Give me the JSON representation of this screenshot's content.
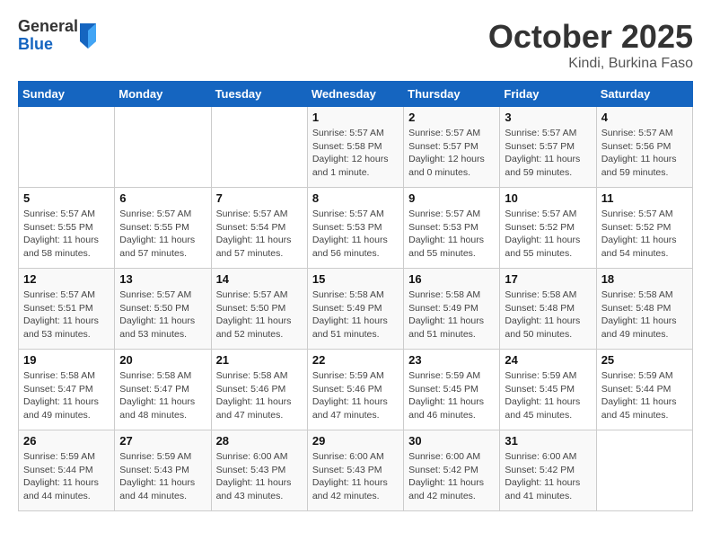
{
  "header": {
    "logo_general": "General",
    "logo_blue": "Blue",
    "month": "October 2025",
    "location": "Kindi, Burkina Faso"
  },
  "days_of_week": [
    "Sunday",
    "Monday",
    "Tuesday",
    "Wednesday",
    "Thursday",
    "Friday",
    "Saturday"
  ],
  "weeks": [
    [
      {
        "day": "",
        "info": ""
      },
      {
        "day": "",
        "info": ""
      },
      {
        "day": "",
        "info": ""
      },
      {
        "day": "1",
        "info": "Sunrise: 5:57 AM\nSunset: 5:58 PM\nDaylight: 12 hours\nand 1 minute."
      },
      {
        "day": "2",
        "info": "Sunrise: 5:57 AM\nSunset: 5:57 PM\nDaylight: 12 hours\nand 0 minutes."
      },
      {
        "day": "3",
        "info": "Sunrise: 5:57 AM\nSunset: 5:57 PM\nDaylight: 11 hours\nand 59 minutes."
      },
      {
        "day": "4",
        "info": "Sunrise: 5:57 AM\nSunset: 5:56 PM\nDaylight: 11 hours\nand 59 minutes."
      }
    ],
    [
      {
        "day": "5",
        "info": "Sunrise: 5:57 AM\nSunset: 5:55 PM\nDaylight: 11 hours\nand 58 minutes."
      },
      {
        "day": "6",
        "info": "Sunrise: 5:57 AM\nSunset: 5:55 PM\nDaylight: 11 hours\nand 57 minutes."
      },
      {
        "day": "7",
        "info": "Sunrise: 5:57 AM\nSunset: 5:54 PM\nDaylight: 11 hours\nand 57 minutes."
      },
      {
        "day": "8",
        "info": "Sunrise: 5:57 AM\nSunset: 5:53 PM\nDaylight: 11 hours\nand 56 minutes."
      },
      {
        "day": "9",
        "info": "Sunrise: 5:57 AM\nSunset: 5:53 PM\nDaylight: 11 hours\nand 55 minutes."
      },
      {
        "day": "10",
        "info": "Sunrise: 5:57 AM\nSunset: 5:52 PM\nDaylight: 11 hours\nand 55 minutes."
      },
      {
        "day": "11",
        "info": "Sunrise: 5:57 AM\nSunset: 5:52 PM\nDaylight: 11 hours\nand 54 minutes."
      }
    ],
    [
      {
        "day": "12",
        "info": "Sunrise: 5:57 AM\nSunset: 5:51 PM\nDaylight: 11 hours\nand 53 minutes."
      },
      {
        "day": "13",
        "info": "Sunrise: 5:57 AM\nSunset: 5:50 PM\nDaylight: 11 hours\nand 53 minutes."
      },
      {
        "day": "14",
        "info": "Sunrise: 5:57 AM\nSunset: 5:50 PM\nDaylight: 11 hours\nand 52 minutes."
      },
      {
        "day": "15",
        "info": "Sunrise: 5:58 AM\nSunset: 5:49 PM\nDaylight: 11 hours\nand 51 minutes."
      },
      {
        "day": "16",
        "info": "Sunrise: 5:58 AM\nSunset: 5:49 PM\nDaylight: 11 hours\nand 51 minutes."
      },
      {
        "day": "17",
        "info": "Sunrise: 5:58 AM\nSunset: 5:48 PM\nDaylight: 11 hours\nand 50 minutes."
      },
      {
        "day": "18",
        "info": "Sunrise: 5:58 AM\nSunset: 5:48 PM\nDaylight: 11 hours\nand 49 minutes."
      }
    ],
    [
      {
        "day": "19",
        "info": "Sunrise: 5:58 AM\nSunset: 5:47 PM\nDaylight: 11 hours\nand 49 minutes."
      },
      {
        "day": "20",
        "info": "Sunrise: 5:58 AM\nSunset: 5:47 PM\nDaylight: 11 hours\nand 48 minutes."
      },
      {
        "day": "21",
        "info": "Sunrise: 5:58 AM\nSunset: 5:46 PM\nDaylight: 11 hours\nand 47 minutes."
      },
      {
        "day": "22",
        "info": "Sunrise: 5:59 AM\nSunset: 5:46 PM\nDaylight: 11 hours\nand 47 minutes."
      },
      {
        "day": "23",
        "info": "Sunrise: 5:59 AM\nSunset: 5:45 PM\nDaylight: 11 hours\nand 46 minutes."
      },
      {
        "day": "24",
        "info": "Sunrise: 5:59 AM\nSunset: 5:45 PM\nDaylight: 11 hours\nand 45 minutes."
      },
      {
        "day": "25",
        "info": "Sunrise: 5:59 AM\nSunset: 5:44 PM\nDaylight: 11 hours\nand 45 minutes."
      }
    ],
    [
      {
        "day": "26",
        "info": "Sunrise: 5:59 AM\nSunset: 5:44 PM\nDaylight: 11 hours\nand 44 minutes."
      },
      {
        "day": "27",
        "info": "Sunrise: 5:59 AM\nSunset: 5:43 PM\nDaylight: 11 hours\nand 44 minutes."
      },
      {
        "day": "28",
        "info": "Sunrise: 6:00 AM\nSunset: 5:43 PM\nDaylight: 11 hours\nand 43 minutes."
      },
      {
        "day": "29",
        "info": "Sunrise: 6:00 AM\nSunset: 5:43 PM\nDaylight: 11 hours\nand 42 minutes."
      },
      {
        "day": "30",
        "info": "Sunrise: 6:00 AM\nSunset: 5:42 PM\nDaylight: 11 hours\nand 42 minutes."
      },
      {
        "day": "31",
        "info": "Sunrise: 6:00 AM\nSunset: 5:42 PM\nDaylight: 11 hours\nand 41 minutes."
      },
      {
        "day": "",
        "info": ""
      }
    ]
  ]
}
